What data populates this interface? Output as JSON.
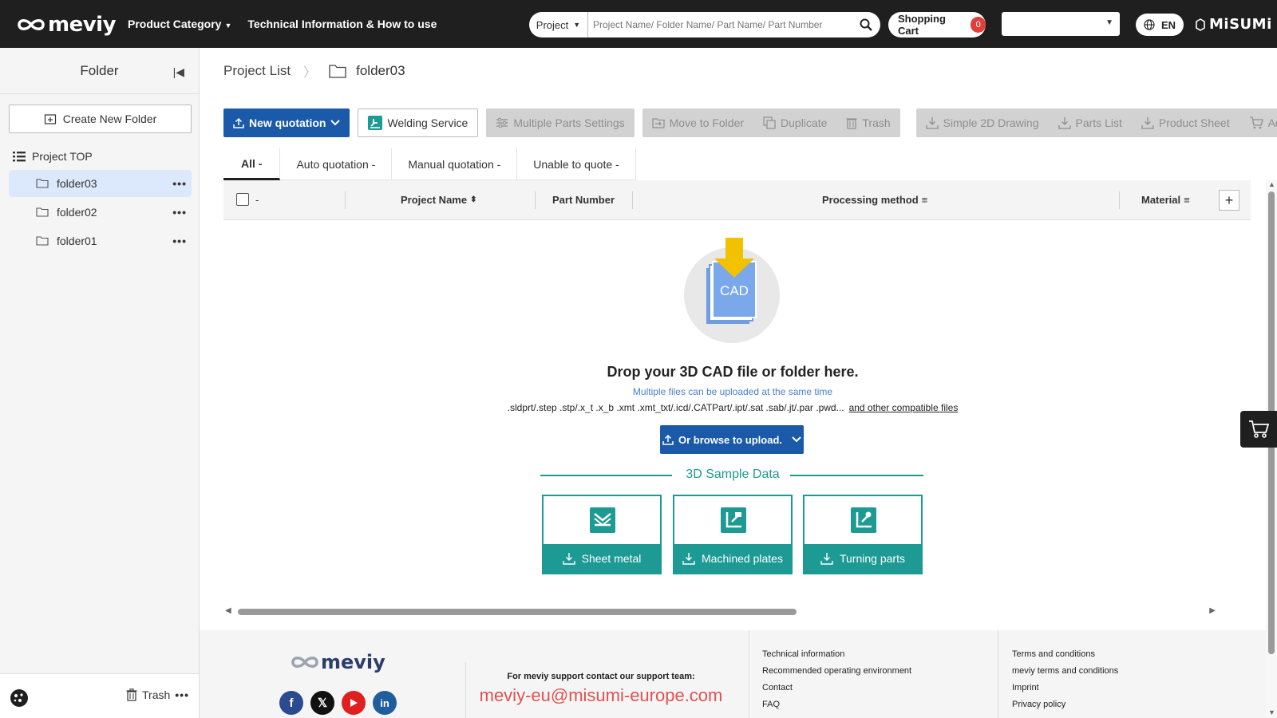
{
  "brand": {
    "name": "meviy",
    "partner": "MiSUMi"
  },
  "topnav": {
    "product_category": "Product Category",
    "technical_info": "Technical Information & How to use"
  },
  "search": {
    "scope": "Project",
    "placeholder": "Project Name/ Folder Name/ Part Name/ Part Number"
  },
  "cart": {
    "label": "Shopping Cart",
    "count": "0"
  },
  "language": {
    "code": "EN"
  },
  "sidebar": {
    "title": "Folder",
    "create_folder": "Create New Folder",
    "project_top": "Project TOP",
    "folders": [
      {
        "label": "folder03",
        "active": true
      },
      {
        "label": "folder02",
        "active": false
      },
      {
        "label": "folder01",
        "active": false
      }
    ],
    "trash": "Trash"
  },
  "breadcrumb": {
    "root": "Project List",
    "current": "folder03"
  },
  "toolbar": {
    "new_quotation": "New quotation",
    "welding_service": "Welding Service",
    "multiple_parts_settings": "Multiple Parts Settings",
    "move_to_folder": "Move to Folder",
    "duplicate": "Duplicate",
    "trash": "Trash",
    "simple_2d_drawing": "Simple 2D Drawing",
    "parts_list": "Parts List",
    "product_sheet": "Product Sheet",
    "add_to_shopping": "Add to Shopp"
  },
  "tabs": [
    "All -",
    "Auto quotation -",
    "Manual quotation -",
    "Unable to quote -"
  ],
  "table": {
    "select_dash": "-",
    "columns": {
      "project_name": "Project Name",
      "part_number": "Part Number",
      "processing_method": "Processing method",
      "material": "Material"
    }
  },
  "dropzone": {
    "icon_label": "CAD",
    "title": "Drop your 3D CAD file or folder here.",
    "subtitle": "Multiple files can be uploaded at the same time",
    "formats": ".sldprt/.step .stp/.x_t .x_b .xmt .xmt_txt/.icd/.CATPart/.ipt/.sat .sab/.jt/.par .pwd...",
    "formats_link": "and other compatible files",
    "browse": "Or browse to upload."
  },
  "samples": {
    "title": "3D Sample Data",
    "items": [
      "Sheet metal",
      "Machined plates",
      "Turning parts"
    ]
  },
  "footer": {
    "logo": "meviy",
    "support_label": "For meviy support contact our support team:",
    "support_email": "meviy-eu@misumi-europe.com",
    "links_col1": [
      "Technical information",
      "Recommended operating environment",
      "Contact",
      "FAQ"
    ],
    "links_col2": [
      "Terms and conditions",
      "meviy terms and conditions",
      "Imprint",
      "Privacy policy"
    ]
  },
  "colors": {
    "primary": "#1a5aa8",
    "teal": "#1c9a93",
    "topbar": "#1f1f1f",
    "badge": "#e0403a",
    "support_email": "#e05151"
  }
}
